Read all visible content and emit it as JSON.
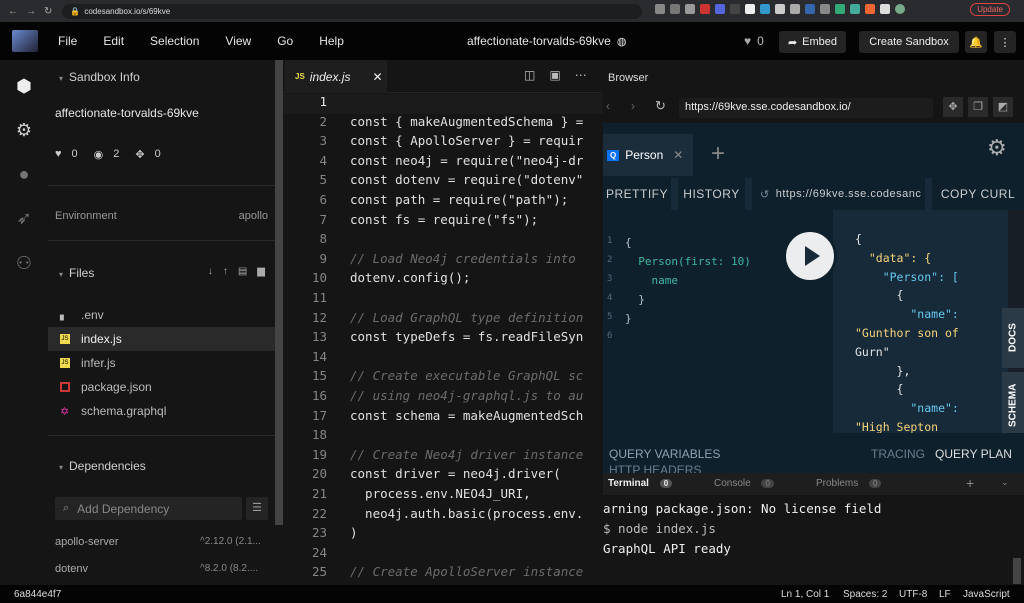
{
  "chrome": {
    "url": "codesandbox.io/s/69kve",
    "update_label": "Update"
  },
  "topbar": {
    "menu": [
      "File",
      "Edit",
      "Selection",
      "View",
      "Go",
      "Help"
    ],
    "sandbox_title": "affectionate-torvalds-69kve",
    "likes": "0",
    "embed_label": "Embed",
    "create_label": "Create Sandbox"
  },
  "sidebar": {
    "info_header": "Sandbox Info",
    "sandbox_name": "affectionate-torvalds-69kve",
    "stats": {
      "likes": "0",
      "views": "2",
      "forks": "0"
    },
    "env_label": "Environment",
    "env_value": "apollo",
    "files_header": "Files",
    "files": [
      {
        "name": ".env",
        "icon": "file-icon"
      },
      {
        "name": "index.js",
        "icon": "js-file-icon"
      },
      {
        "name": "infer.js",
        "icon": "js-file-icon"
      },
      {
        "name": "package.json",
        "icon": "npm-icon"
      },
      {
        "name": "schema.graphql",
        "icon": "graphql-icon"
      }
    ],
    "deps_header": "Dependencies",
    "add_dep_placeholder": "Add Dependency",
    "deps": [
      {
        "name": "apollo-server",
        "version": "^2.12.0 (2.1..."
      },
      {
        "name": "dotenv",
        "version": "^8.2.0 (8.2...."
      }
    ]
  },
  "editor": {
    "tab_label": "index.js",
    "tab_prefix": "JS",
    "lines": [
      {
        "n": "1",
        "t": ""
      },
      {
        "n": "2",
        "t": "const { makeAugmentedSchema } = "
      },
      {
        "n": "3",
        "t": "const { ApolloServer } = requir"
      },
      {
        "n": "4",
        "t": "const neo4j = require(\"neo4j-dr"
      },
      {
        "n": "5",
        "t": "const dotenv = require(\"dotenv\""
      },
      {
        "n": "6",
        "t": "const path = require(\"path\");"
      },
      {
        "n": "7",
        "t": "const fs = require(\"fs\");"
      },
      {
        "n": "8",
        "t": ""
      },
      {
        "n": "9",
        "t": "// Load Neo4j credentials into "
      },
      {
        "n": "10",
        "t": "dotenv.config();"
      },
      {
        "n": "11",
        "t": ""
      },
      {
        "n": "12",
        "t": "// Load GraphQL type definition"
      },
      {
        "n": "13",
        "t": "const typeDefs = fs.readFileSyn"
      },
      {
        "n": "14",
        "t": ""
      },
      {
        "n": "15",
        "t": "// Create executable GraphQL sc"
      },
      {
        "n": "16",
        "t": "// using neo4j-graphql.js to au"
      },
      {
        "n": "17",
        "t": "const schema = makeAugmentedSch"
      },
      {
        "n": "18",
        "t": ""
      },
      {
        "n": "19",
        "t": "// Create Neo4j driver instance"
      },
      {
        "n": "20",
        "t": "const driver = neo4j.driver("
      },
      {
        "n": "21",
        "t": "  process.env.NEO4J_URI,"
      },
      {
        "n": "22",
        "t": "  neo4j.auth.basic(process.env."
      },
      {
        "n": "23",
        "t": ")"
      },
      {
        "n": "24",
        "t": ""
      },
      {
        "n": "25",
        "t": "// Create ApolloServer instance"
      }
    ]
  },
  "browser": {
    "header": "Browser",
    "url": "https://69kve.sse.codesandbox.io/",
    "gql_tab": "Person",
    "prettify": "PRETTIFY",
    "history": "HISTORY",
    "endpoint": "https://69kve.sse.codesanc",
    "copy_curl": "COPY CURL",
    "query_lines": [
      {
        "n": "1",
        "t": "{"
      },
      {
        "n": "2",
        "t": "  Person(first: 10)"
      },
      {
        "n": "3",
        "t": "    name"
      },
      {
        "n": "4",
        "t": "  }"
      },
      {
        "n": "5",
        "t": "}"
      },
      {
        "n": "6",
        "t": ""
      }
    ],
    "result_lines": [
      "{",
      "  \"data\": {",
      "    \"Person\": [",
      "      {",
      "        \"name\":",
      "\"Gunthor son of",
      "Gurn\"",
      "      },",
      "      {",
      "        \"name\":",
      "\"High Septon"
    ],
    "docs": "DOCS",
    "schema": "SCHEMA",
    "query_variables": "QUERY VARIABLES",
    "http_headers": "HTTP HEADERS",
    "tracing": "TRACING",
    "query_plan": "QUERY PLAN"
  },
  "terminal": {
    "tabs": [
      {
        "label": "Terminal",
        "count": "0"
      },
      {
        "label": "Console",
        "count": "0"
      },
      {
        "label": "Problems",
        "count": "0"
      }
    ],
    "lines": [
      "arning package.json: No license field",
      "$ node index.js",
      "GraphQL API ready"
    ]
  },
  "status": {
    "id": "6a844e4f7",
    "position": "Ln 1, Col 1",
    "spaces": "Spaces: 2",
    "encoding": "UTF-8",
    "eol": "LF",
    "language": "JavaScript"
  },
  "colors": {
    "accent": "#0971f1",
    "graphql_pink": "#e535ab",
    "js_yellow": "#f0db4f"
  }
}
